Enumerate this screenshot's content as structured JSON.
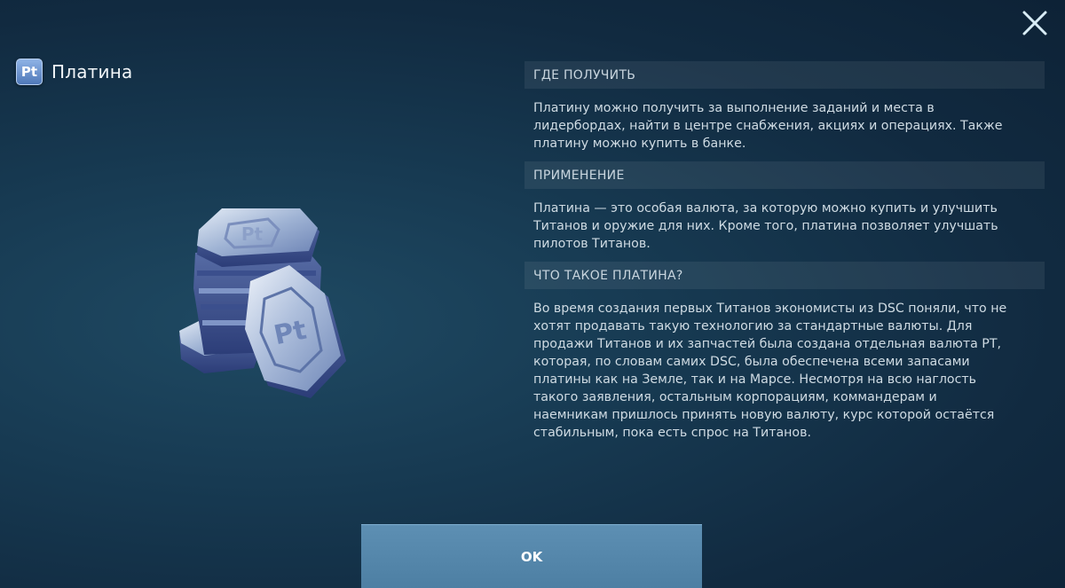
{
  "header": {
    "badge_text": "Pt",
    "title": "Платина"
  },
  "icons": {
    "close": "close-icon",
    "currency": "platinum-coins-icon"
  },
  "sections": [
    {
      "heading": "ГДЕ ПОЛУЧИТЬ",
      "lines": [
        "Платину можно получить за выполнение заданий и места в",
        "лидербордах, найти в центре снабжения, акциях и операциях. Также",
        "платину можно купить в банке."
      ]
    },
    {
      "heading": "ПРИМЕНЕНИЕ",
      "lines": [
        "Платина — это особая валюта, за которую можно купить и улучшить",
        "Титанов и оружие для них. Кроме того, платина позволяет улучшать",
        "пилотов Титанов."
      ]
    },
    {
      "heading": "ЧТО ТАКОЕ ПЛАТИНА?",
      "lines": [
        "Во время создания первых Титанов экономисты из DSC поняли, что не",
        "хотят продавать такую технологию за стандартные валюты. Для",
        "продажи Титанов и их запчастей была создана отдельная валюта PT,",
        "которая, по словам самих DSC, была обеспечена всеми запасами",
        "платины как на Земле, так и на Марсе. Несмотря на всю наглость",
        "такого заявления, остальным корпорациям, коммандерам и",
        "наемникам пришлось принять новую валюту, курс которой остаётся",
        "стабильным, пока есть спрос на Титанов."
      ]
    }
  ],
  "footer": {
    "ok_label": "OK"
  },
  "colors": {
    "background": "#173a52",
    "ok_button": "#5489ad",
    "badge": "#5f86c4"
  }
}
